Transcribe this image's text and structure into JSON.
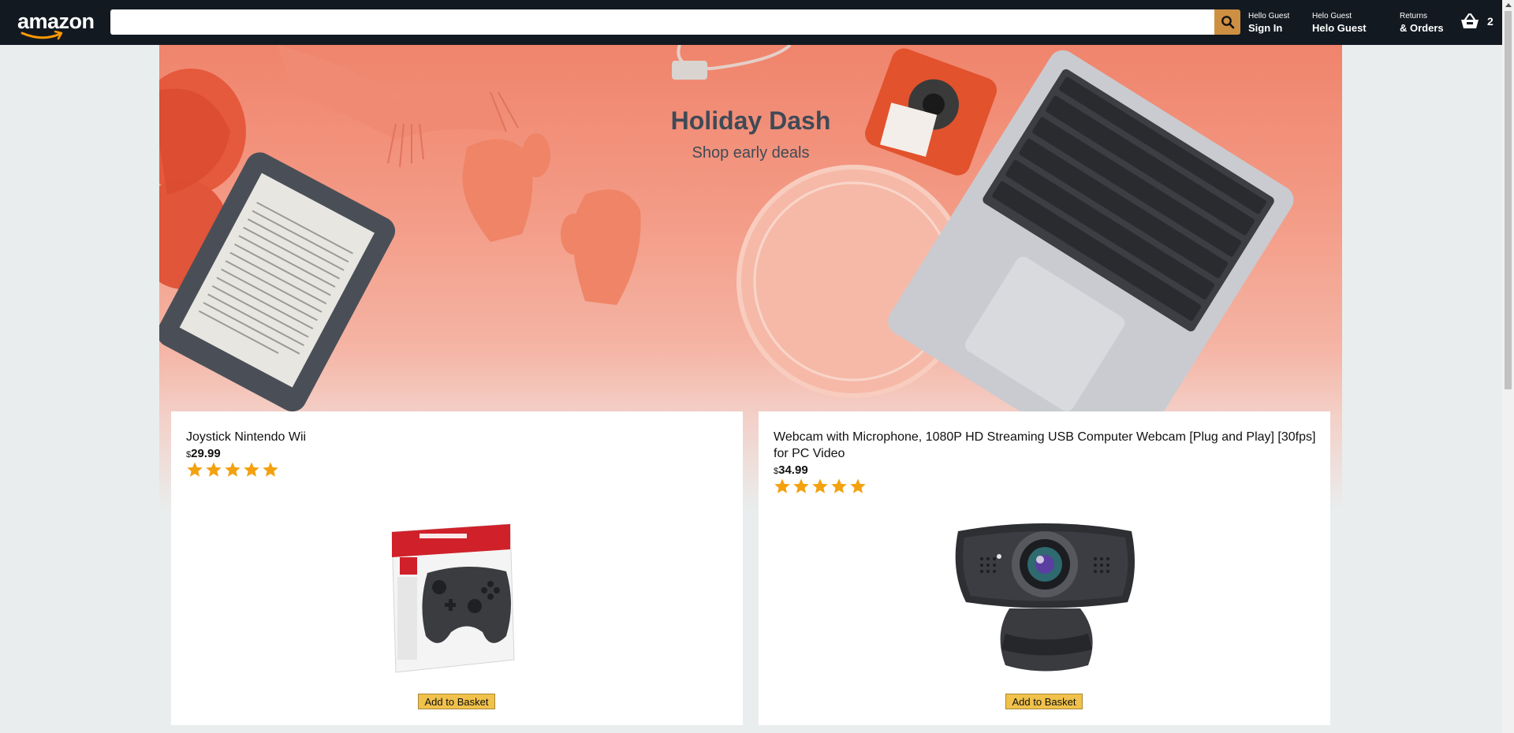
{
  "header": {
    "logo_text": "amazon",
    "search": {
      "value": "",
      "placeholder": ""
    },
    "sign_in": {
      "line1": "Hello Guest",
      "line2": "Sign In"
    },
    "account": {
      "line1": "Helo Guest",
      "line2": "Helo Guest"
    },
    "orders": {
      "line1": "Returns",
      "line2": "& Orders"
    },
    "basket_count": "2"
  },
  "hero": {
    "title": "Holiday Dash",
    "subtitle": "Shop early deals"
  },
  "products": [
    {
      "title": "Joystick Nintendo Wii",
      "currency": "$",
      "price": "29.99",
      "rating": 5,
      "image_icon": "game-controller",
      "button_label": "Add to Basket"
    },
    {
      "title": "Webcam with Microphone, 1080P HD Streaming USB Computer Webcam [Plug and Play] [30fps] for PC Video",
      "currency": "$",
      "price": "34.99",
      "rating": 5,
      "image_icon": "webcam",
      "button_label": "Add to Basket"
    }
  ],
  "colors": {
    "header_bg": "#131921",
    "search_button": "#cd9042",
    "page_bg": "#eaeded",
    "star": "#f3a10f",
    "button_bg": "#f0c14b"
  }
}
